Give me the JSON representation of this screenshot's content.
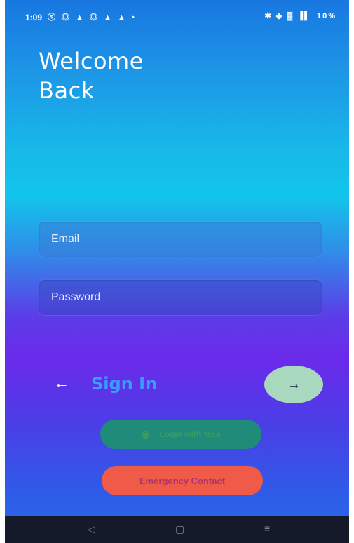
{
  "status_bar": {
    "time": "1:09",
    "left_icons": "ⓢ ◎ ▲ ◎ ▲ ▲ •",
    "right_icons": "✱ ◆ ▓ ▐▌",
    "battery": "10%"
  },
  "header": {
    "title_line1": "Welcome",
    "title_line2": "Back"
  },
  "form": {
    "email_placeholder": "Email",
    "password_placeholder": "Password"
  },
  "actions": {
    "signin_label": "Sign In",
    "back_glyph": "←",
    "next_glyph": "→",
    "login_with_face_label": "Login with face",
    "emergency_label": "Emergency Contact"
  },
  "nav_bar": {
    "back_glyph": "◁",
    "home_glyph": "▢",
    "recent_glyph": "≡"
  },
  "colors": {
    "signin_accent": "#3c9dff",
    "next_button": "#a8d8bd",
    "face_button": "#1f8b79",
    "emergency_button": "#f05a48"
  }
}
